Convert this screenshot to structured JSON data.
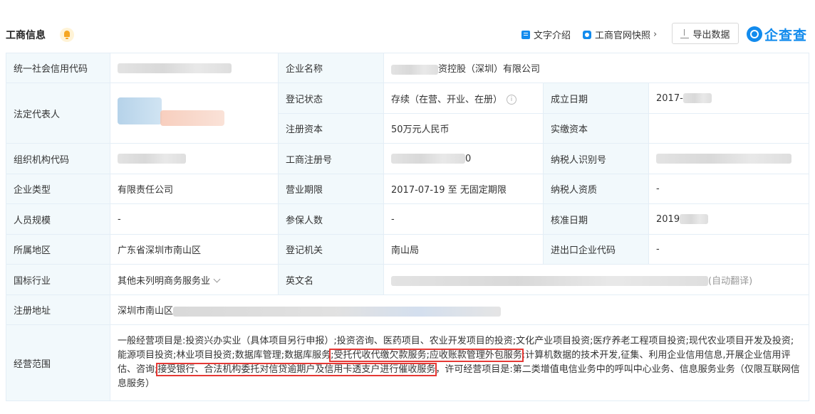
{
  "header": {
    "title": "工商信息",
    "text_intro": "文字介绍",
    "snapshot": "工商官网快照",
    "export": "导出数据",
    "logo": "企查查"
  },
  "table": {
    "credit_code_label": "统一社会信用代码",
    "company_name_label": "企业名称",
    "company_name_value": "资控股（深圳）有限公司",
    "legal_rep_label": "法定代表人",
    "reg_status_label": "登记状态",
    "reg_status_value": "存续（在营、开业、在册）",
    "established_label": "成立日期",
    "established_value": "2017-",
    "reg_capital_label": "注册资本",
    "reg_capital_value": "50万元人民币",
    "paid_capital_label": "实缴资本",
    "org_code_label": "组织机构代码",
    "reg_no_label": "工商注册号",
    "reg_no_value": "0",
    "taxpayer_id_label": "纳税人识别号",
    "company_type_label": "企业类型",
    "company_type_value": "有限责任公司",
    "term_label": "营业期限",
    "term_value": "2017-07-19 至 无固定期限",
    "taxpayer_qual_label": "纳税人资质",
    "taxpayer_qual_value": "-",
    "staff_label": "人员规模",
    "staff_value": "-",
    "insured_label": "参保人数",
    "insured_value": "-",
    "approval_label": "核准日期",
    "approval_value": "2019",
    "region_label": "所属地区",
    "region_value": "广东省深圳市南山区",
    "authority_label": "登记机关",
    "authority_value": "南山局",
    "import_export_label": "进出口企业代码",
    "import_export_value": "-",
    "industry_label": "国标行业",
    "industry_value": "其他未列明商务服务业",
    "english_name_label": "英文名",
    "english_name_note": "(自动翻译)",
    "address_label": "注册地址",
    "address_value": "深圳市南山区",
    "scope_label": "经营范围",
    "scope": {
      "part1": "一般经营项目是:投资兴办实业（具体项目另行申报）;投资咨询、医药项目、农业开发项目的投资;文化产业项目投资;医疗养老工程项目投资;现代农业项目开发及投资;能源项目投资;林业项目投资;数据库管理;数据库服务",
      "hl1": ";受托代收代缴欠款服务;应收账款管理外包服务",
      "part2": ";计算机数据的技术开发,征集、利用企业信用信息,开展企业信用评估、咨询;",
      "hl2": "接受银行、合法机构委托对信贷逾期户及信用卡透支户进行催收服务",
      "part3": "，许可经营项目是:第二类增值电信业务中的呼叫中心业务、信息服务业务（仅限互联网信息服务）"
    }
  }
}
